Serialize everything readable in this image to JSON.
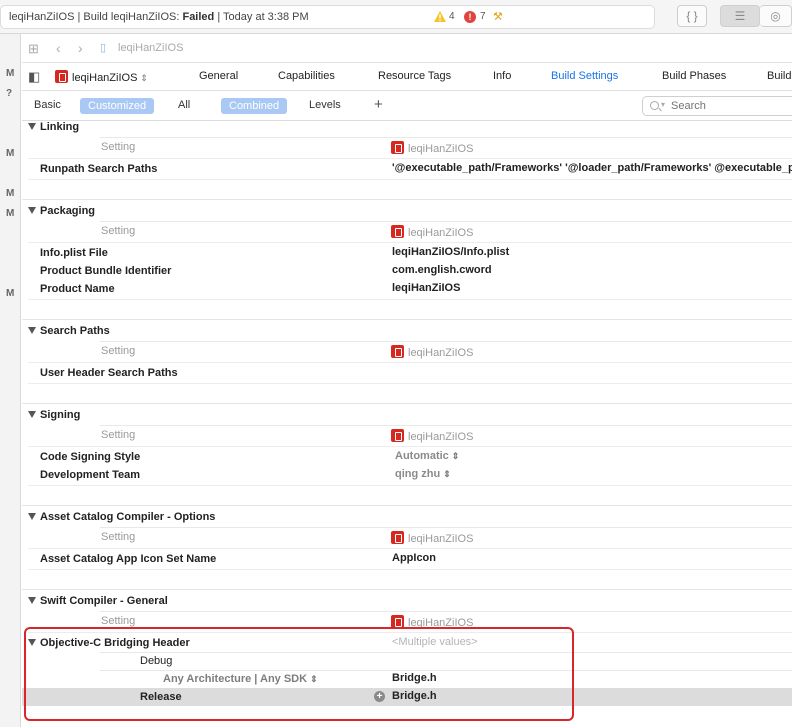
{
  "status": {
    "project": "leqiHanZiIOS",
    "build_prefix": "Build leqiHanZiIOS:",
    "result": "Failed",
    "time": "Today at 3:38 PM",
    "warnings": "4",
    "errors": "7"
  },
  "jumpbar": {
    "file": "leqiHanZiIOS"
  },
  "tabs": {
    "target": "leqiHanZiIOS",
    "items": [
      "General",
      "Capabilities",
      "Resource Tags",
      "Info",
      "Build Settings",
      "Build Phases",
      "Build Rules"
    ],
    "active": "Build Settings"
  },
  "filter": {
    "basic": "Basic",
    "customized": "Customized",
    "all": "All",
    "combined": "Combined",
    "levels": "Levels",
    "add": "+",
    "search_placeholder": "Search"
  },
  "gutter_marks": [
    "M",
    "?",
    "M",
    "M",
    "M",
    "M"
  ],
  "header_setting": "Setting",
  "header_target": "leqiHanZiIOS",
  "sections": {
    "linking": {
      "title": "Linking",
      "runpath_name": "Runpath Search Paths",
      "runpath_value": "'@executable_path/Frameworks' '@loader_path/Frameworks' @executable_path/Frameworks"
    },
    "packaging": {
      "title": "Packaging",
      "infoplist_name": "Info.plist File",
      "infoplist_value": "leqiHanZiIOS/Info.plist",
      "bundle_name": "Product Bundle Identifier",
      "bundle_value": "com.english.cword",
      "product_name": "Product Name",
      "product_value": "leqiHanZiIOS"
    },
    "search": {
      "title": "Search Paths",
      "user_header_name": "User Header Search Paths"
    },
    "signing": {
      "title": "Signing",
      "style_name": "Code Signing Style",
      "style_value": "Automatic",
      "team_name": "Development Team",
      "team_value": "qing zhu"
    },
    "asset": {
      "title": "Asset Catalog Compiler - Options",
      "icon_name": "Asset Catalog App Icon Set Name",
      "icon_value": "AppIcon"
    },
    "swift": {
      "title": "Swift Compiler - General",
      "bridging_name": "Objective-C Bridging Header",
      "bridging_value": "<Multiple values>",
      "debug": "Debug",
      "any_arch": "Any Architecture | Any SDK",
      "debug_value": "Bridge.h",
      "release": "Release",
      "release_value": "Bridge.h"
    }
  }
}
